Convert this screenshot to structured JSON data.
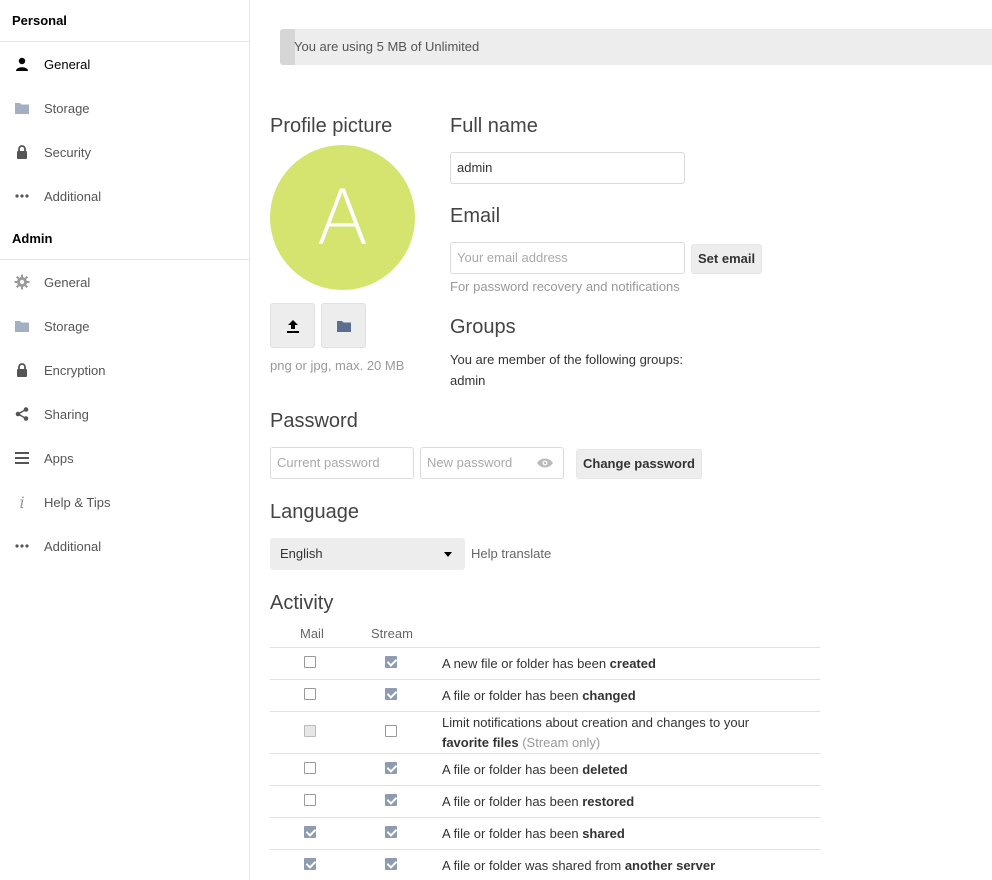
{
  "sidebar": {
    "personal_heading": "Personal",
    "personal_items": [
      {
        "label": "General",
        "icon": "person-icon"
      },
      {
        "label": "Storage",
        "icon": "folder-icon"
      },
      {
        "label": "Security",
        "icon": "lock-icon"
      },
      {
        "label": "Additional",
        "icon": "more-icon"
      }
    ],
    "admin_heading": "Admin",
    "admin_items": [
      {
        "label": "General",
        "icon": "gear-icon"
      },
      {
        "label": "Storage",
        "icon": "folder-icon"
      },
      {
        "label": "Encryption",
        "icon": "lock-icon"
      },
      {
        "label": "Sharing",
        "icon": "share-icon"
      },
      {
        "label": "Apps",
        "icon": "menu-icon"
      },
      {
        "label": "Help & Tips",
        "icon": "info-icon"
      },
      {
        "label": "Additional",
        "icon": "more-icon"
      }
    ]
  },
  "quota": {
    "text": "You are using 5 MB of Unlimited",
    "used_fraction": 0.02
  },
  "profile": {
    "heading": "Profile picture",
    "avatar_letter": "A",
    "avatar_color": "#d5e46e",
    "hint": "png or jpg, max. 20 MB"
  },
  "fullname": {
    "heading": "Full name",
    "value": "admin"
  },
  "email": {
    "heading": "Email",
    "placeholder": "Your email address",
    "button": "Set email",
    "hint": "For password recovery and notifications"
  },
  "groups": {
    "heading": "Groups",
    "text": "You are member of the following groups:",
    "list": "admin"
  },
  "password": {
    "heading": "Password",
    "current_placeholder": "Current password",
    "new_placeholder": "New password",
    "button": "Change password"
  },
  "language": {
    "heading": "Language",
    "selected": "English",
    "help_link": "Help translate"
  },
  "activity": {
    "heading": "Activity",
    "col_mail": "Mail",
    "col_stream": "Stream",
    "rows": [
      {
        "pre": "A new file or folder has been ",
        "bold": "created",
        "post": "",
        "mail": false,
        "stream": true
      },
      {
        "pre": "A file or folder has been ",
        "bold": "changed",
        "post": "",
        "mail": false,
        "stream": true
      },
      {
        "pre": "Limit notifications about creation and changes to your ",
        "bold": "favorite files",
        "post": " (Stream only)",
        "mail": false,
        "mail_disabled": true,
        "stream": false
      },
      {
        "pre": "A file or folder has been ",
        "bold": "deleted",
        "post": "",
        "mail": false,
        "stream": true
      },
      {
        "pre": "A file or folder has been ",
        "bold": "restored",
        "post": "",
        "mail": false,
        "stream": true
      },
      {
        "pre": "A file or folder has been ",
        "bold": "shared",
        "post": "",
        "mail": true,
        "stream": true
      },
      {
        "pre": "A file or folder was shared from ",
        "bold": "another server",
        "post": "",
        "mail": true,
        "stream": true
      }
    ]
  }
}
